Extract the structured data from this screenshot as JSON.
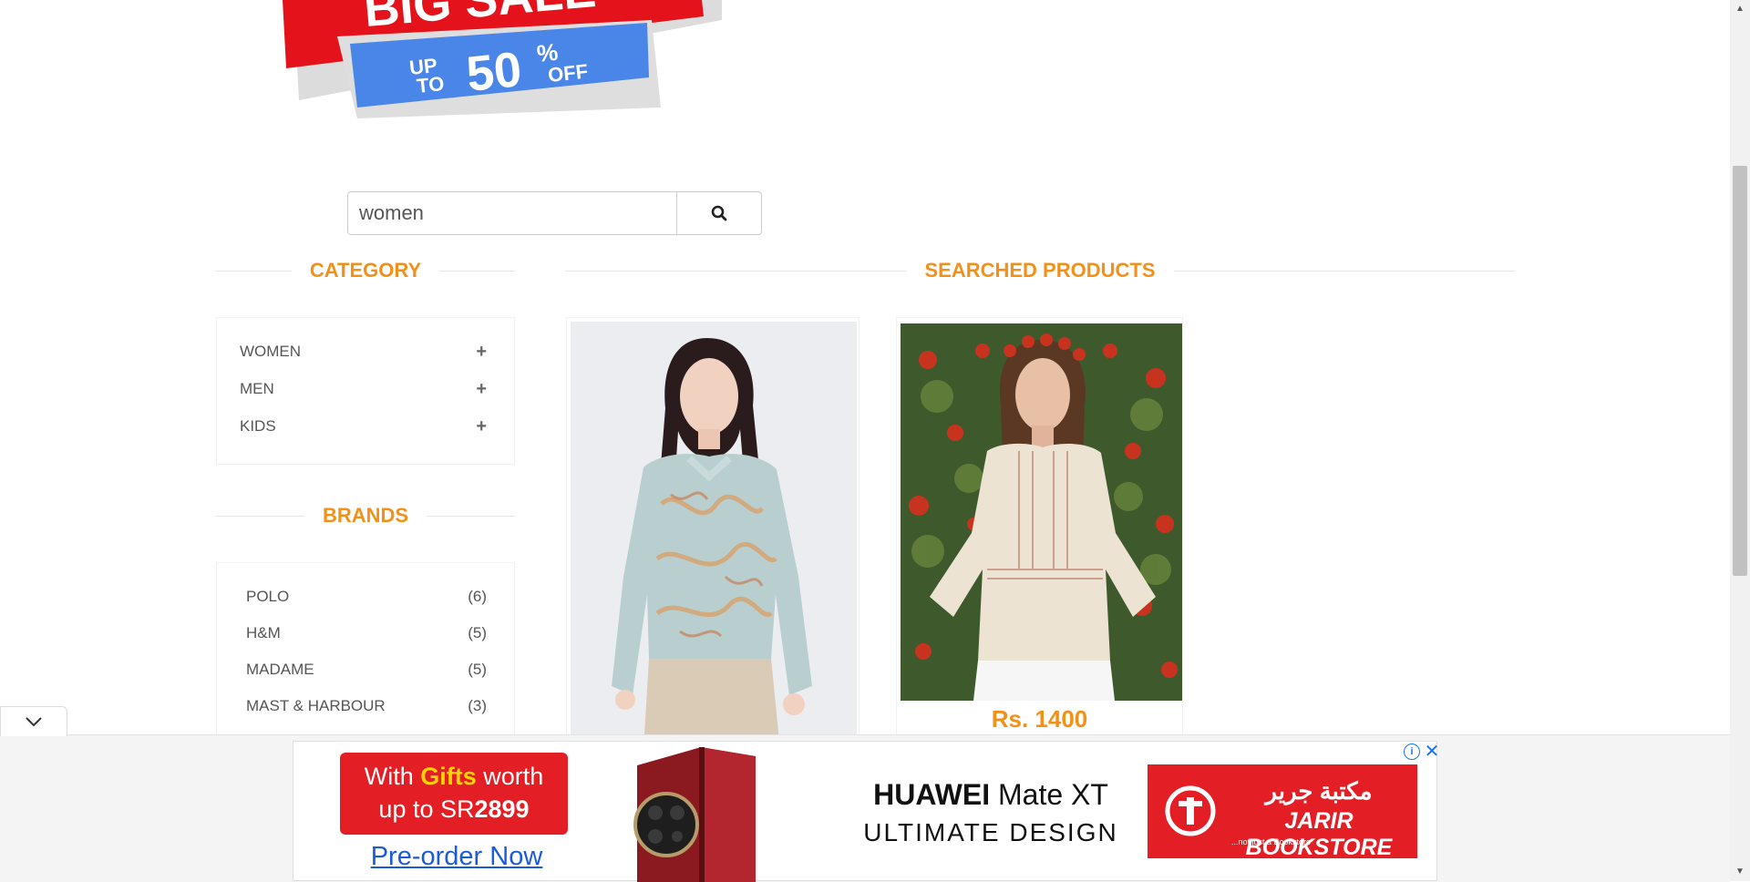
{
  "banner": {
    "line1": "BIG SALE",
    "line2_a": "UP",
    "line2_b": "TO",
    "percent": "50",
    "percent_sign": "%",
    "off": "OFF"
  },
  "search": {
    "value": "women",
    "button_icon": "search-icon"
  },
  "category": {
    "title": "CATEGORY",
    "items": [
      {
        "label": "WOMEN",
        "icon": "plus-icon"
      },
      {
        "label": "MEN",
        "icon": "plus-icon"
      },
      {
        "label": "KIDS",
        "icon": "plus-icon"
      }
    ]
  },
  "brands": {
    "title": "BRANDS",
    "items": [
      {
        "label": "POLO",
        "count": "(6)"
      },
      {
        "label": "H&M",
        "count": "(5)"
      },
      {
        "label": "MADAME",
        "count": "(5)"
      },
      {
        "label": "MAST & HARBOUR",
        "count": "(3)"
      }
    ]
  },
  "products": {
    "title": "SEARCHED PRODUCTS",
    "items": [
      {
        "image": "woman-floral-blouse-photo",
        "price": ""
      },
      {
        "image": "woman-lace-top-photo",
        "price": "Rs. 1400"
      }
    ]
  },
  "ad": {
    "gift_line1_a": "With ",
    "gift_line1_b": "Gifts",
    "gift_line1_c": " worth",
    "gift_line2_a": "up to SR",
    "gift_line2_b": "2899",
    "preorder": "Pre-order Now",
    "headline_brand": "HUAWEI",
    "headline_model": " Mate XT",
    "headline_tag": "ULTIMATE DESIGN",
    "store_name": "JARIR BOOKSTORE",
    "store_arabic": "مكتبة جرير",
    "store_tagline": "...not just a Bookstore",
    "info_icon": "info-icon",
    "close_icon": "close-icon",
    "colors": {
      "red": "#e31e24",
      "link": "#1a5bd8",
      "gold": "#ffd400"
    }
  },
  "colors": {
    "accent": "#f29018",
    "banner_red": "#e4131b",
    "banner_blue": "#4a86e8"
  }
}
